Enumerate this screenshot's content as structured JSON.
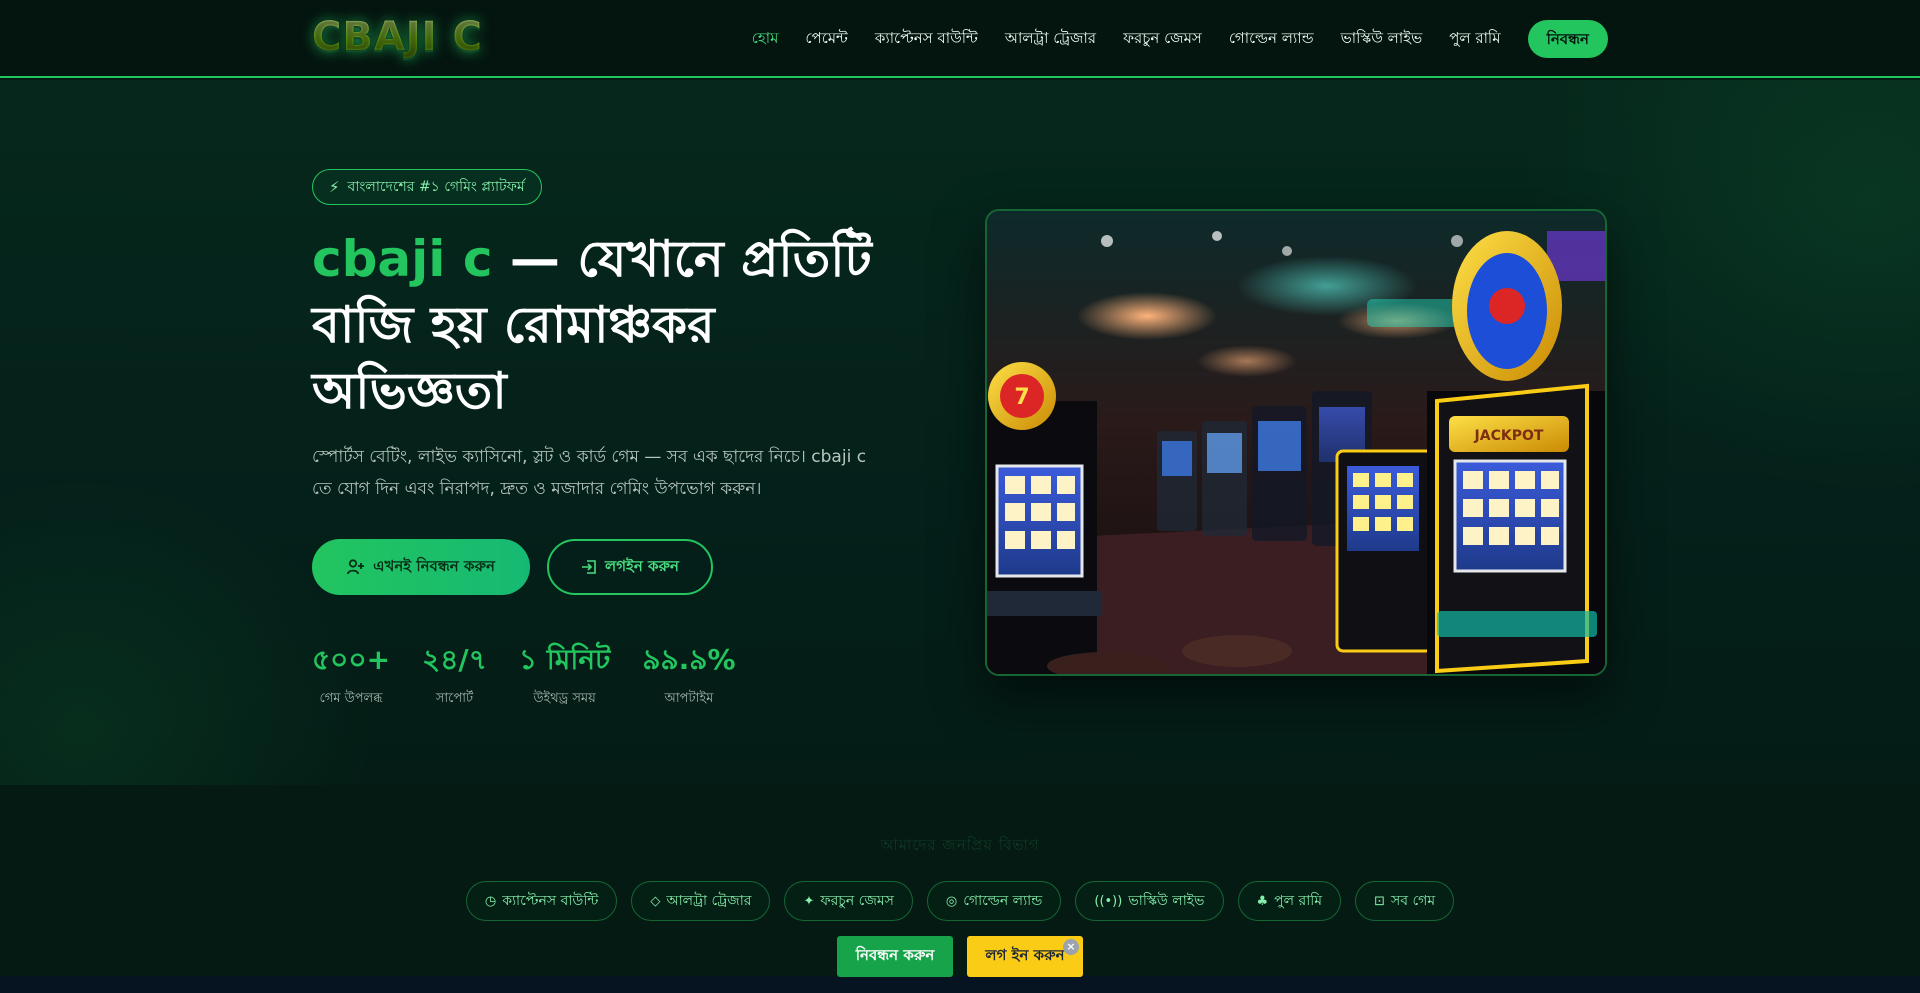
{
  "header": {
    "logo": "CBAJI C",
    "nav": [
      {
        "label": "হোম",
        "active": true
      },
      {
        "label": "পেমেন্ট",
        "active": false
      },
      {
        "label": "ক্যাপ্টেনস বাউন্টি",
        "active": false
      },
      {
        "label": "আলট্রা ট্রেজার",
        "active": false
      },
      {
        "label": "ফরচুন জেমস",
        "active": false
      },
      {
        "label": "গোল্ডেন ল্যান্ড",
        "active": false
      },
      {
        "label": "ভাস্কিউ লাইভ",
        "active": false
      },
      {
        "label": "পুল রামি",
        "active": false
      }
    ],
    "cta": "নিবন্ধন"
  },
  "hero": {
    "badge": "বাংলাদেশের #১ গেমিং প্ল্যাটফর্ম",
    "title_brand": "cbaji c",
    "title_rest": " — যেখানে প্রতিটি বাজি হয় রোমাঞ্চকর অভিজ্ঞতা",
    "description": "স্পোর্টস বেটিং, লাইভ ক্যাসিনো, স্লট ও কার্ড গেম — সব এক ছাদের নিচে। cbaji c তে যোগ দিন এবং নিরাপদ, দ্রুত ও মজাদার গেমিং উপভোগ করুন।",
    "primary_button": "এখনই নিবন্ধন করুন",
    "secondary_button": "লগইন করুন",
    "stats": [
      {
        "value": "৫০০+",
        "label": "গেম উপলব্ধ"
      },
      {
        "value": "২৪/৭",
        "label": "সাপোর্ট"
      },
      {
        "value": "১ মিনিট",
        "label": "উইথড্র সময়"
      },
      {
        "value": "৯৯.৯%",
        "label": "আপটাইম"
      }
    ]
  },
  "features": {
    "heading": "আমাদের জনপ্রিয় বিভাগ",
    "chips": [
      {
        "icon": "compass-icon",
        "label": "ক্যাপ্টেনস বাউন্টি"
      },
      {
        "icon": "gem-icon",
        "label": "আলট্রা ট্রেজার"
      },
      {
        "icon": "sparkle-icon",
        "label": "ফরচুন জেমস"
      },
      {
        "icon": "coin-icon",
        "label": "গোল্ডেন ল্যান্ড"
      },
      {
        "icon": "broadcast-icon",
        "label": "ভাস্কিউ লাইভ"
      },
      {
        "icon": "club-icon",
        "label": "পুল রামি"
      },
      {
        "icon": "gamepad-icon",
        "label": "সব গেম"
      }
    ]
  },
  "floating": {
    "register": "নিবন্ধন করুন",
    "login": "লগ ইন করুন"
  },
  "colors": {
    "accent": "#22c55e",
    "background": "#041a12",
    "login_button": "#facc15"
  }
}
